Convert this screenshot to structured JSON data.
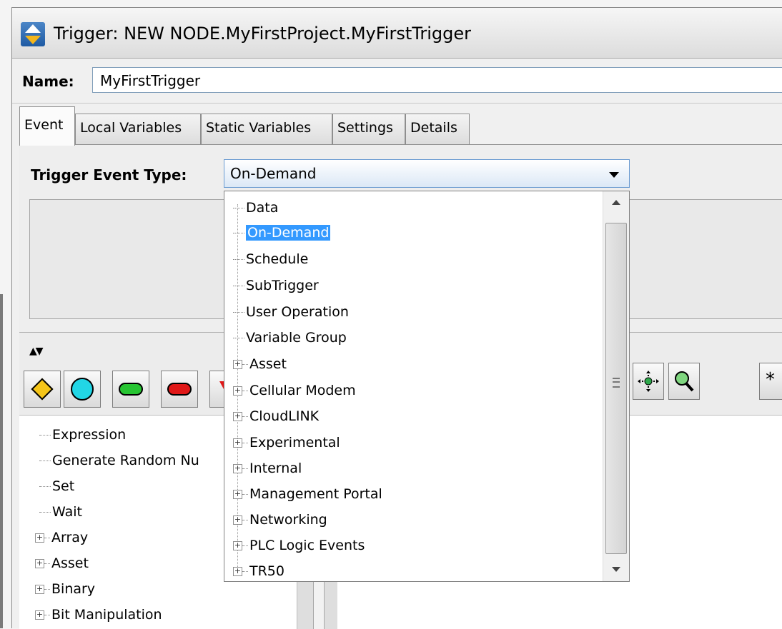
{
  "window": {
    "title": "Trigger:  NEW NODE.MyFirstProject.MyFirstTrigger"
  },
  "name": {
    "label": "Name:",
    "value": "MyFirstTrigger"
  },
  "tabs": [
    {
      "label": "Event",
      "active": true
    },
    {
      "label": "Local Variables",
      "active": false
    },
    {
      "label": "Static Variables",
      "active": false
    },
    {
      "label": "Settings",
      "active": false
    },
    {
      "label": "Details",
      "active": false
    }
  ],
  "event": {
    "label": "Trigger Event Type:",
    "selected": "On-Demand"
  },
  "dropdown": {
    "items": [
      {
        "label": "Data",
        "expandable": false
      },
      {
        "label": "On-Demand",
        "expandable": false,
        "selected": true
      },
      {
        "label": "Schedule",
        "expandable": false
      },
      {
        "label": "SubTrigger",
        "expandable": false
      },
      {
        "label": "User Operation",
        "expandable": false
      },
      {
        "label": "Variable Group",
        "expandable": false
      },
      {
        "label": "Asset",
        "expandable": true
      },
      {
        "label": "Cellular Modem",
        "expandable": true
      },
      {
        "label": "CloudLINK",
        "expandable": true
      },
      {
        "label": "Experimental",
        "expandable": true
      },
      {
        "label": "Internal",
        "expandable": true
      },
      {
        "label": "Management Portal",
        "expandable": true
      },
      {
        "label": "Networking",
        "expandable": true
      },
      {
        "label": "PLC Logic Events",
        "expandable": true
      },
      {
        "label": "TR50",
        "expandable": true
      }
    ]
  },
  "toolbar": {
    "buttons": [
      "diamond-shape-icon",
      "circle-shape-icon",
      "green-pill-icon",
      "red-pill-icon",
      "red-triangle-icon"
    ],
    "right_buttons": [
      "move-node-icon",
      "zoom-icon",
      "star-icon"
    ]
  },
  "tree": {
    "items": [
      {
        "label": "Expression",
        "expandable": false
      },
      {
        "label": "Generate Random Nu",
        "expandable": false
      },
      {
        "label": "Set",
        "expandable": false
      },
      {
        "label": "Wait",
        "expandable": false
      },
      {
        "label": "Array",
        "expandable": true
      },
      {
        "label": "Asset",
        "expandable": true
      },
      {
        "label": "Binary",
        "expandable": true
      },
      {
        "label": "Bit Manipulation",
        "expandable": true
      }
    ]
  },
  "colors": {
    "selection": "#3399ff",
    "combo_border": "#6a9bd1"
  }
}
